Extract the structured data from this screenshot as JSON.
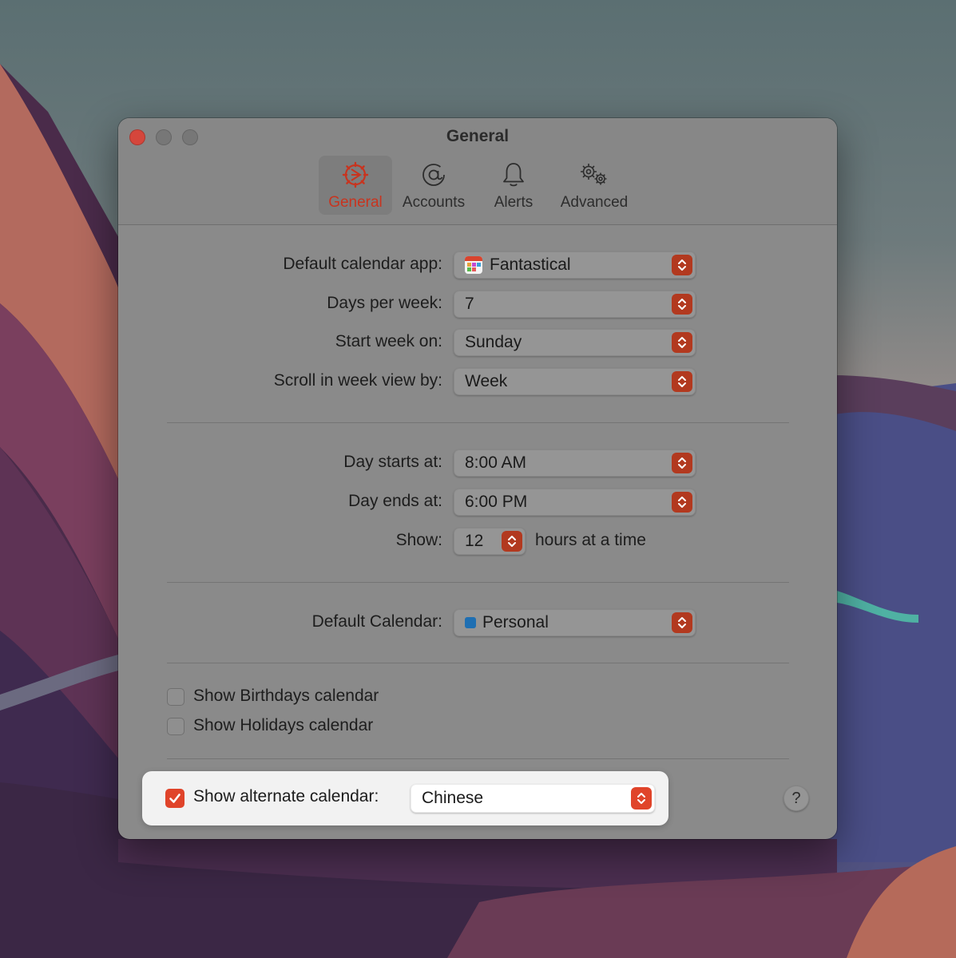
{
  "window": {
    "title": "General"
  },
  "toolbar": {
    "tabs": [
      {
        "label": "General",
        "icon": "gear-wheel-icon",
        "selected": true
      },
      {
        "label": "Accounts",
        "icon": "at-sign-icon",
        "selected": false
      },
      {
        "label": "Alerts",
        "icon": "bell-icon",
        "selected": false
      },
      {
        "label": "Advanced",
        "icon": "gears-icon",
        "selected": false
      }
    ]
  },
  "general": {
    "default_app": {
      "label": "Default calendar app:",
      "value": "Fantastical"
    },
    "days_per_week": {
      "label": "Days per week:",
      "value": "7"
    },
    "start_week_on": {
      "label": "Start week on:",
      "value": "Sunday"
    },
    "scroll_week": {
      "label": "Scroll in week view by:",
      "value": "Week"
    },
    "day_starts": {
      "label": "Day starts at:",
      "value": "8:00 AM"
    },
    "day_ends": {
      "label": "Day ends at:",
      "value": "6:00 PM"
    },
    "show_hours": {
      "label": "Show:",
      "value": "12",
      "suffix": "hours at a time"
    },
    "default_calendar": {
      "label": "Default Calendar:",
      "value": "Personal",
      "color": "#1f6fb2"
    },
    "birthdays": {
      "label": "Show Birthdays calendar",
      "checked": false
    },
    "holidays": {
      "label": "Show Holidays calendar",
      "checked": false
    },
    "alternate": {
      "label": "Show alternate calendar:",
      "checked": true,
      "value": "Chinese"
    },
    "help_label": "?"
  },
  "colors": {
    "accent": "#e0442a",
    "close_button": "#d5463c"
  }
}
